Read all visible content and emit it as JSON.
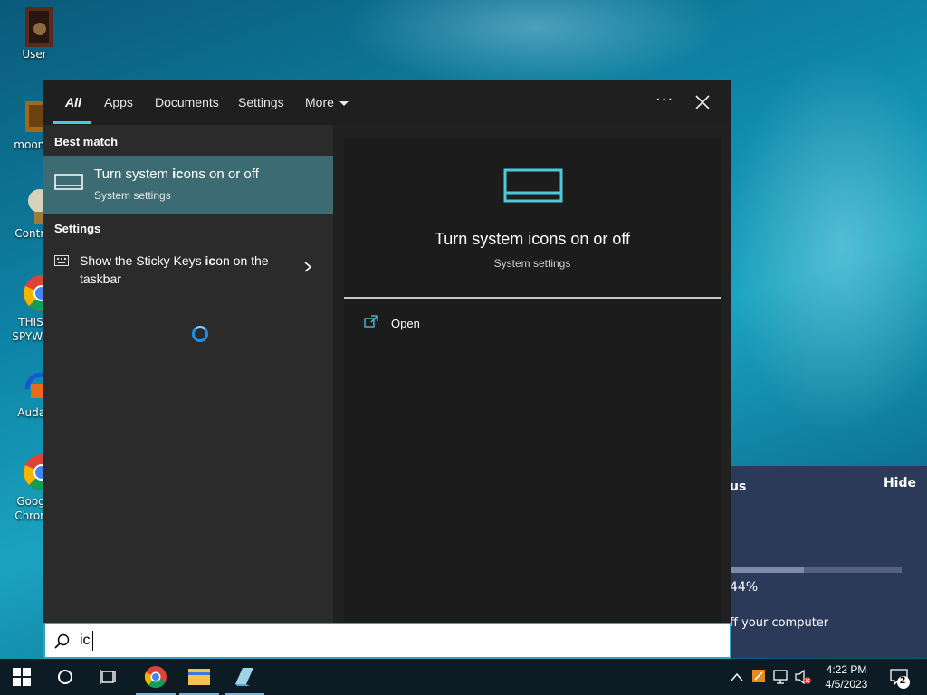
{
  "desktop": {
    "icons": [
      {
        "label": "User"
      },
      {
        "label": "moon g"
      },
      {
        "label": "Control"
      },
      {
        "label": "THIS SPYWA"
      },
      {
        "label": "Audac"
      },
      {
        "label": "Goog Chron"
      }
    ]
  },
  "background_panel": {
    "title_fragment": "us",
    "hide_label": "Hide",
    "percent": "44%",
    "progress": 0.44,
    "message_fragment": "ff your computer"
  },
  "search": {
    "tabs": [
      {
        "label": "All",
        "active": true
      },
      {
        "label": "Apps"
      },
      {
        "label": "Documents"
      },
      {
        "label": "Settings"
      },
      {
        "label": "More"
      }
    ],
    "ellipsis": "···",
    "best_match_heading": "Best match",
    "best_match": {
      "title_prefix": "Turn system ",
      "title_bold": "ic",
      "title_suffix": "ons on or off",
      "subtitle": "System settings"
    },
    "settings_heading": "Settings",
    "settings_item": {
      "title_prefix": "Show the Sticky Keys ",
      "title_bold": "ic",
      "title_suffix": "on on the taskbar"
    },
    "preview": {
      "title": "Turn system icons on or off",
      "subtitle": "System settings",
      "open_label": "Open"
    },
    "query": "ic"
  },
  "taskbar": {
    "time": "4:22 PM",
    "date": "4/5/2023",
    "notification_count": "2"
  }
}
